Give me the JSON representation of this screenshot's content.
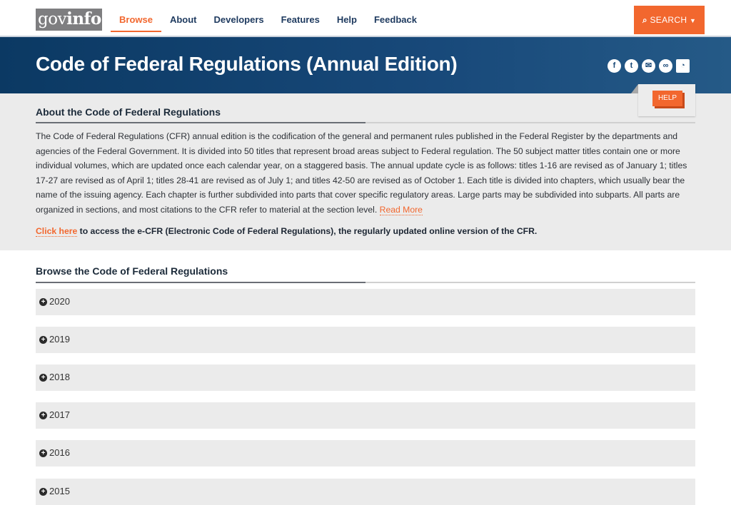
{
  "header": {
    "logo": {
      "light": "gov",
      "bold": "info"
    },
    "nav": [
      {
        "label": "Browse",
        "active": true
      },
      {
        "label": "About"
      },
      {
        "label": "Developers"
      },
      {
        "label": "Features"
      },
      {
        "label": "Help"
      },
      {
        "label": "Feedback"
      }
    ],
    "search_label": "SEARCH"
  },
  "banner": {
    "title": "Code of Federal Regulations (Annual Edition)",
    "social_icons": [
      "facebook-icon",
      "twitter-icon",
      "email-icon",
      "link-icon",
      "rss-icon"
    ]
  },
  "about": {
    "help_label": "HELP",
    "title": "About the Code of Federal Regulations",
    "body": "The Code of Federal Regulations (CFR) annual edition is the codification of the general and permanent rules published in the Federal Register by the departments and agencies of the Federal Government. It is divided into 50 titles that represent broad areas subject to Federal regulation. The 50 subject matter titles contain one or more individual volumes, which are updated once each calendar year, on a staggered basis. The annual update cycle is as follows: titles 1-16 are revised as of January 1; titles 17-27 are revised as of April 1; titles 28-41 are revised as of July 1; and titles 42-50 are revised as of October 1. Each title is divided into chapters, which usually bear the name of the issuing agency. Each chapter is further subdivided into parts that cover specific regulatory areas. Large parts may be subdivided into subparts. All parts are organized in sections, and most citations to the CFR refer to material at the section level.",
    "read_more": "Read More",
    "ecfr_link": "Click here",
    "ecfr_text": " to access the e-CFR (Electronic Code of Federal Regulations), the regularly updated online version of the CFR."
  },
  "browse": {
    "title": "Browse the Code of Federal Regulations",
    "years": [
      "2020",
      "2019",
      "2018",
      "2017",
      "2016",
      "2015"
    ]
  }
}
